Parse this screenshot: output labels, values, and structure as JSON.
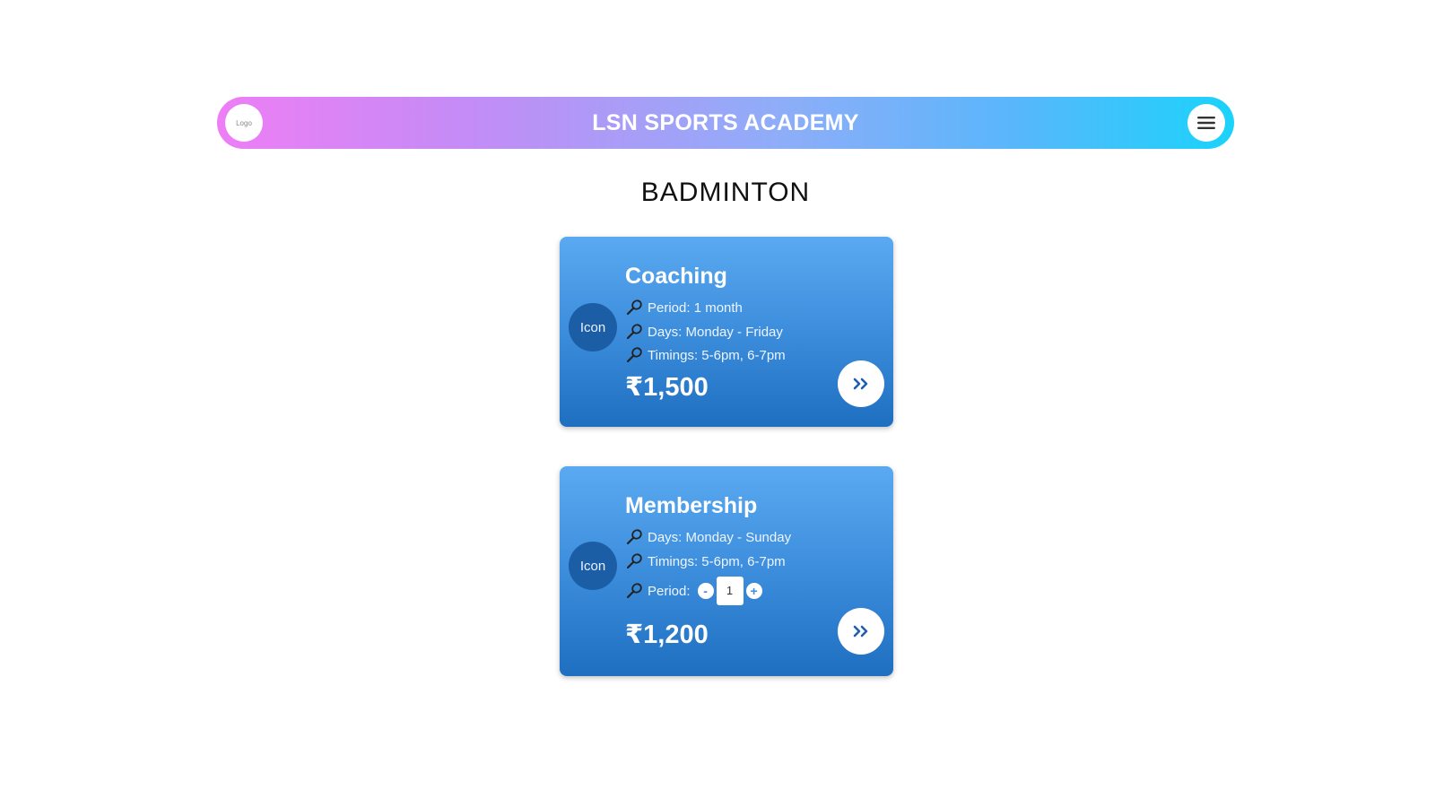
{
  "header": {
    "logo_text": "Logo",
    "title": "LSN SPORTS ACADEMY",
    "menu_icon": "hamburger-menu-icon"
  },
  "section": {
    "title": "BADMINTON"
  },
  "cards": {
    "coaching": {
      "icon_label": "Icon",
      "title": "Coaching",
      "details": [
        "Period: 1 month",
        "Days: Monday - Friday",
        "Timings: 5-6pm, 6-7pm"
      ],
      "price": "₹1,500",
      "go_icon": "double-chevron-right-icon"
    },
    "membership": {
      "icon_label": "Icon",
      "title": "Membership",
      "details": [
        "Days: Monday - Sunday",
        "Timings: 5-6pm, 6-7pm"
      ],
      "period_label": "Period:",
      "period_decrement": "-",
      "period_value": "1",
      "period_increment": "+",
      "price": "₹1,200",
      "go_icon": "double-chevron-right-icon"
    }
  },
  "colors": {
    "header_gradient_start": "#ee7ef5",
    "header_gradient_end": "#1ad3fb",
    "card_blue_top": "#5aa9f1",
    "card_blue_bottom": "#1f6fc1",
    "icon_circle": "#1c5ea6"
  }
}
